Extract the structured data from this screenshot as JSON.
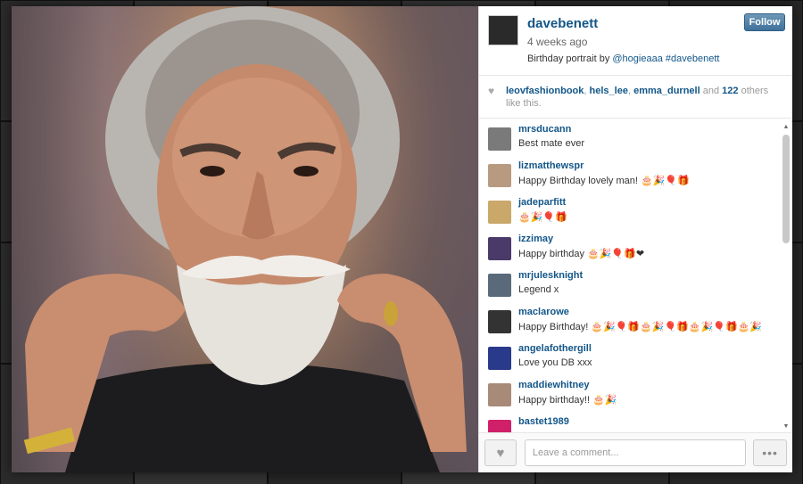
{
  "post": {
    "username": "davebenett",
    "time": "4 weeks ago",
    "caption_text": "Birthday portrait by",
    "caption_mention": "@hogieaaa",
    "caption_hashtag": "#davebenett",
    "follow_label": "Follow"
  },
  "likes": {
    "icon": "heart-icon",
    "likers": [
      "leovfashionbook",
      "hels_lee",
      "emma_durnell"
    ],
    "sep": ",",
    "and_text": "and",
    "others_count": "122",
    "others_text": "others like this."
  },
  "comments": [
    {
      "user": "mrsducann",
      "text": "Best mate ever",
      "avatar_color": "#7a7a7a"
    },
    {
      "user": "lizmatthewspr",
      "text": "Happy Birthday lovely man! 🎂🎉🎈🎁",
      "avatar_color": "#b89a80"
    },
    {
      "user": "jadeparfitt",
      "text": "🎂🎉🎈🎁",
      "avatar_color": "#c9a86a"
    },
    {
      "user": "izzimay",
      "text": "Happy birthday 🎂🎉🎈🎁❤",
      "avatar_color": "#4a3a6a"
    },
    {
      "user": "mrjulesknight",
      "text": "Legend x",
      "avatar_color": "#5a6a7a"
    },
    {
      "user": "maclarowe",
      "text": "Happy Birthday! 🎂🎉🎈🎁🎂🎉🎈🎁🎂🎉🎈🎁🎂🎉",
      "avatar_color": "#333333"
    },
    {
      "user": "angelafothergill",
      "text": "Love you DB xxx",
      "avatar_color": "#2a3a8a"
    },
    {
      "user": "maddiewhitney",
      "text": "Happy birthday!! 🎂🎉",
      "avatar_color": "#a88a78"
    },
    {
      "user": "bastet1989",
      "text": "",
      "avatar_color": "#d0206a"
    }
  ],
  "footer": {
    "like_icon": "heart-icon",
    "comment_placeholder": "Leave a comment...",
    "more_icon": "ellipsis-icon",
    "more_label": "•••"
  },
  "photo": {
    "subject": "portrait of bearded man twirling moustache"
  }
}
